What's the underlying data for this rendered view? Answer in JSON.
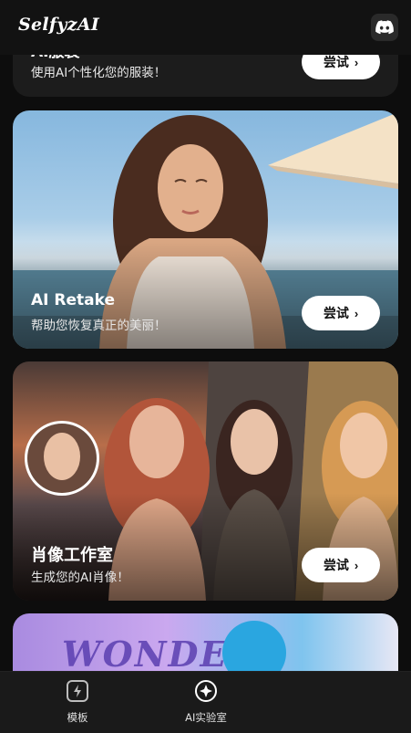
{
  "app": {
    "title": "SelfyzAI"
  },
  "cards": [
    {
      "title": "AI服装",
      "subtitle": "使用AI个性化您的服装！",
      "button": "尝试"
    },
    {
      "title": "AI Retake",
      "subtitle": "帮助您恢复真正的美丽！",
      "button": "尝试"
    },
    {
      "title": "肖像工作室",
      "subtitle": "生成您的AI肖像！",
      "button": "尝试"
    },
    {
      "banner_text": "WONDER"
    }
  ],
  "tabs": [
    {
      "label": "模板",
      "icon": "template-lightning-icon"
    },
    {
      "label": "AI实验室",
      "icon": "ai-lab-plus-icon"
    }
  ],
  "icons": {
    "discord": "discord-icon",
    "chevron": "chevron-right-icon"
  },
  "colors": {
    "background": "#0d0d0d",
    "button": "#ffffff",
    "header": "#121212"
  }
}
